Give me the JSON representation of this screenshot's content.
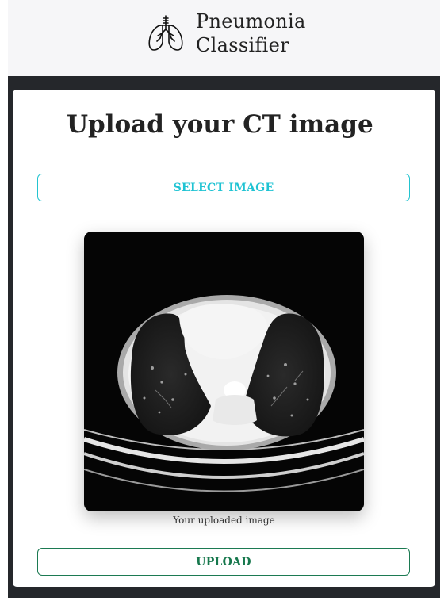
{
  "header": {
    "brand_line1": "Pneumonia",
    "brand_line2": "Classifier",
    "logo_icon": "lungs-icon"
  },
  "card": {
    "title": "Upload your CT image",
    "select_button_label": "SELECT IMAGE",
    "preview_caption": "Your uploaded image",
    "upload_button_label": "UPLOAD"
  },
  "colors": {
    "select_accent": "#1fc3d3",
    "upload_accent": "#17784d",
    "frame_dark": "#25272b",
    "header_bg": "#f6f6f8"
  }
}
